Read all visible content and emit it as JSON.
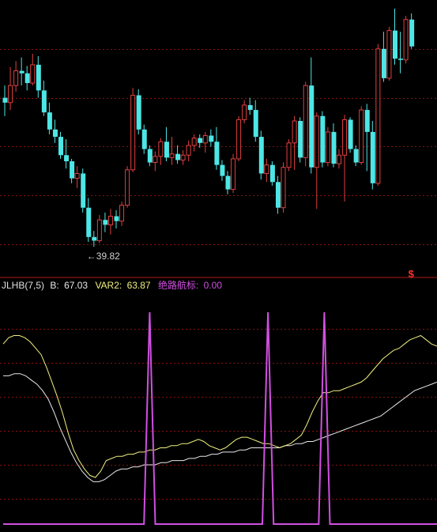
{
  "indicator": {
    "name": "JLHB(7,5)",
    "fields": [
      {
        "label": "B:",
        "value": "67.03",
        "color": "#e8e8e8"
      },
      {
        "label": "VAR2:",
        "value": "63.87",
        "color": "#f0f080"
      },
      {
        "label": "绝路航标:",
        "value": "0.00",
        "color": "#d050e0"
      }
    ]
  },
  "price_panel": {
    "min_label": "←39.82",
    "signal_marker": "$",
    "colors": {
      "up": "#e04040",
      "down": "#4de6e6",
      "grid": "#8a1010",
      "marker": "#ff3030"
    }
  },
  "chart_data": [
    {
      "type": "candlestick",
      "title": "",
      "ylim": [
        38,
        60
      ],
      "y_min_marked": 39.82,
      "signal_index": 73,
      "candles": [
        [
          52.0,
          53.0,
          50.5,
          51.6
        ],
        [
          51.6,
          54.5,
          51.0,
          53.0
        ],
        [
          53.0,
          55.0,
          52.5,
          54.2
        ],
        [
          54.2,
          55.3,
          53.0,
          54.0
        ],
        [
          54.0,
          54.6,
          52.6,
          53.2
        ],
        [
          53.2,
          55.6,
          53.0,
          54.7
        ],
        [
          54.7,
          55.4,
          52.0,
          52.6
        ],
        [
          52.6,
          53.4,
          50.5,
          50.8
        ],
        [
          50.8,
          51.6,
          49.0,
          49.4
        ],
        [
          49.4,
          50.2,
          48.3,
          48.8
        ],
        [
          48.8,
          49.2,
          47.0,
          47.3
        ],
        [
          47.3,
          48.6,
          46.2,
          46.8
        ],
        [
          46.8,
          47.0,
          45.0,
          45.4
        ],
        [
          45.4,
          46.4,
          44.6,
          45.8
        ],
        [
          45.8,
          46.2,
          42.6,
          43.0
        ],
        [
          43.0,
          43.8,
          40.2,
          40.6
        ],
        [
          40.6,
          41.1,
          39.8,
          40.3
        ],
        [
          40.3,
          42.4,
          40.1,
          42.0
        ],
        [
          42.0,
          42.6,
          41.0,
          41.6
        ],
        [
          41.6,
          42.9,
          40.8,
          42.3
        ],
        [
          42.3,
          42.8,
          41.3,
          41.9
        ],
        [
          41.9,
          43.5,
          41.5,
          43.2
        ],
        [
          43.2,
          46.4,
          43.0,
          46.1
        ],
        [
          46.1,
          52.8,
          45.9,
          52.2
        ],
        [
          52.2,
          52.7,
          49.0,
          49.4
        ],
        [
          49.4,
          49.8,
          47.4,
          47.8
        ],
        [
          47.8,
          48.1,
          46.4,
          46.7
        ],
        [
          46.7,
          47.6,
          46.0,
          47.2
        ],
        [
          47.2,
          48.7,
          46.5,
          48.4
        ],
        [
          48.4,
          49.6,
          46.8,
          47.1
        ],
        [
          47.1,
          48.8,
          46.5,
          47.4
        ],
        [
          47.4,
          48.1,
          46.6,
          46.9
        ],
        [
          46.9,
          47.7,
          46.5,
          47.3
        ],
        [
          47.3,
          48.5,
          46.8,
          48.1
        ],
        [
          48.1,
          49.0,
          47.6,
          48.7
        ],
        [
          48.7,
          49.0,
          47.9,
          48.3
        ],
        [
          48.3,
          49.2,
          47.5,
          48.9
        ],
        [
          48.9,
          49.4,
          48.0,
          48.4
        ],
        [
          48.4,
          49.6,
          46.1,
          46.5
        ],
        [
          46.5,
          46.9,
          45.2,
          45.6
        ],
        [
          45.6,
          46.0,
          44.1,
          44.5
        ],
        [
          44.5,
          47.4,
          44.2,
          47.0
        ],
        [
          47.0,
          50.5,
          46.8,
          50.2
        ],
        [
          50.2,
          51.8,
          49.9,
          51.4
        ],
        [
          51.4,
          52.0,
          50.6,
          51.0
        ],
        [
          51.0,
          51.8,
          48.4,
          48.8
        ],
        [
          48.8,
          49.3,
          45.3,
          45.8
        ],
        [
          45.8,
          47.0,
          45.1,
          46.5
        ],
        [
          46.5,
          46.8,
          44.8,
          45.1
        ],
        [
          45.1,
          45.6,
          42.5,
          43.0
        ],
        [
          43.0,
          46.7,
          42.6,
          46.3
        ],
        [
          46.3,
          48.6,
          46.0,
          48.3
        ],
        [
          48.3,
          50.5,
          46.1,
          50.1
        ],
        [
          50.1,
          50.4,
          46.7,
          47.1
        ],
        [
          47.1,
          53.3,
          46.4,
          53.0
        ],
        [
          53.0,
          55.3,
          45.8,
          46.3
        ],
        [
          46.3,
          50.8,
          42.9,
          50.5
        ],
        [
          50.5,
          50.9,
          46.3,
          46.7
        ],
        [
          46.7,
          49.6,
          46.4,
          49.2
        ],
        [
          49.2,
          49.9,
          46.3,
          46.6
        ],
        [
          46.6,
          47.8,
          46.2,
          47.3
        ],
        [
          47.3,
          50.6,
          43.5,
          50.2
        ],
        [
          50.2,
          50.4,
          47.5,
          47.8
        ],
        [
          47.8,
          48.1,
          46.4,
          46.7
        ],
        [
          46.7,
          51.3,
          46.5,
          51.0
        ],
        [
          51.0,
          51.5,
          46.0,
          49.2
        ],
        [
          49.2,
          50.1,
          44.5,
          45.0
        ],
        [
          45.0,
          56.4,
          44.8,
          56.0
        ],
        [
          56.0,
          57.4,
          53.3,
          53.6
        ],
        [
          53.6,
          57.8,
          53.4,
          57.5
        ],
        [
          57.5,
          59.3,
          54.7,
          55.2
        ],
        [
          55.2,
          57.4,
          54.0,
          55.1
        ],
        [
          55.1,
          58.7,
          54.8,
          58.4
        ],
        [
          58.4,
          58.9,
          56.0,
          56.2
        ]
      ]
    },
    {
      "type": "line",
      "title": "",
      "ylim": [
        0,
        100
      ],
      "series": [
        {
          "name": "B",
          "color": "#e8e8e8",
          "values": [
            70,
            70,
            71,
            71,
            70,
            68,
            66,
            63,
            59,
            53,
            46,
            40,
            34,
            29,
            25,
            22,
            20,
            20,
            21,
            23,
            25,
            26,
            26,
            27,
            27,
            28,
            28,
            28,
            29,
            29,
            30,
            30,
            30,
            31,
            31,
            32,
            32,
            33,
            33,
            34,
            34,
            34,
            35,
            35,
            36,
            36,
            36,
            36,
            36,
            36,
            37,
            37,
            38,
            38,
            39,
            39,
            40,
            41,
            42,
            43,
            44,
            45,
            46,
            47,
            48,
            49,
            50,
            51,
            53,
            55,
            57,
            59,
            61,
            63,
            64,
            65,
            66,
            67
          ]
        },
        {
          "name": "VAR2",
          "color": "#f0f080",
          "values": [
            85,
            88,
            89,
            89,
            88,
            86,
            83,
            80,
            74,
            67,
            60,
            52,
            43,
            35,
            30,
            26,
            23,
            22,
            25,
            30,
            31,
            32,
            32,
            33,
            33,
            34,
            34,
            35,
            35,
            36,
            36,
            37,
            37,
            38,
            38,
            39,
            40,
            39,
            37,
            36,
            35,
            36,
            38,
            40,
            41,
            41,
            40,
            39,
            38,
            38,
            37,
            36,
            37,
            38,
            40,
            42,
            47,
            53,
            58,
            62,
            62,
            63,
            63,
            64,
            65,
            66,
            67,
            69,
            72,
            75,
            78,
            80,
            82,
            83,
            85,
            87,
            88,
            89,
            87,
            85,
            84
          ]
        },
        {
          "name": "绝路航标",
          "color": "#d050e0",
          "values": [
            0,
            0,
            0,
            0,
            0,
            0,
            0,
            0,
            0,
            0,
            0,
            0,
            0,
            0,
            0,
            0,
            0,
            0,
            0,
            0,
            0,
            0,
            0,
            0,
            0,
            0,
            0,
            0,
            0,
            0,
            0,
            0,
            0,
            0,
            0,
            0,
            0,
            0,
            0,
            0,
            0,
            0,
            0,
            0,
            0,
            0,
            0,
            0,
            0,
            0,
            0,
            0,
            0,
            0,
            0,
            0,
            0,
            0,
            0,
            0,
            0,
            0,
            0,
            0,
            0,
            0,
            0,
            0,
            0,
            0,
            0,
            0,
            0,
            0,
            0,
            0,
            0,
            0
          ]
        }
      ],
      "spikes": [
        {
          "index": 26,
          "value": 100
        },
        {
          "index": 47,
          "value": 100
        },
        {
          "index": 57,
          "value": 100
        }
      ],
      "current_values": {
        "B": 67.03,
        "VAR2": 63.87,
        "绝路航标": 0.0
      }
    }
  ]
}
